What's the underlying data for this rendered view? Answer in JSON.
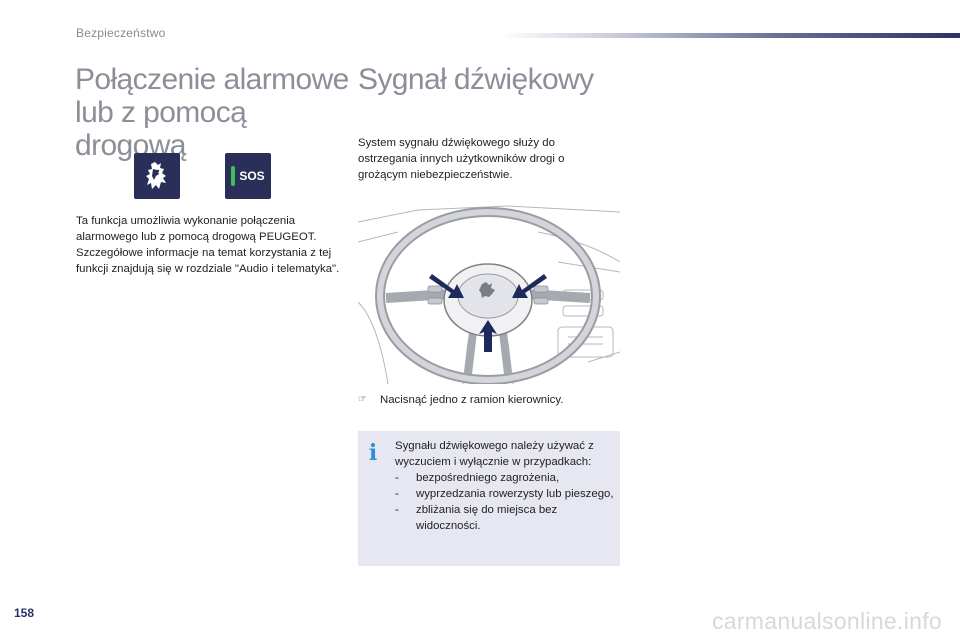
{
  "header": {
    "section": "Bezpieczeństwo"
  },
  "left": {
    "title_line1": "Połączenie alarmowe",
    "title_line2": "lub z pomocą drogową",
    "icons": [
      "peugeot-lion-icon",
      "sos-icon"
    ],
    "sos_label": "SOS",
    "paragraph": "Ta funkcja umożliwia wykonanie połączenia alarmowego lub z pomocą drogową PEUGEOT. Szczegółowe informacje na temat korzystania z tej funkcji znajdują się w rozdziale \"Audio i telematyka\"."
  },
  "right": {
    "title": "Sygnał dźwiękowy",
    "paragraph": "System sygnału dźwiękowego służy do ostrzegania innych użytkowników drogi o grożącym niebezpieczeństwie.",
    "step_bullet": "☞",
    "step": "Nacisnąć jedno z ramion kierownicy.",
    "info": {
      "icon": "info-icon",
      "intro": "Sygnału dźwiękowego należy używać z wyczuciem i wyłącznie w przypadkach:",
      "items": [
        "bezpośredniego zagrożenia,",
        "wyprzedzania rowerzysty lub pieszego,",
        "zbliżania się do miejsca bez widoczności."
      ],
      "dash": "-"
    }
  },
  "footer": {
    "page_number": "158",
    "watermark": "carmanualsonline.info"
  },
  "colors": {
    "accent": "#2c3266",
    "title_gray": "#8c8f98",
    "info_bg": "#e6e7f0",
    "info_icon": "#2f8fd6",
    "sos_green": "#3ec05a"
  }
}
